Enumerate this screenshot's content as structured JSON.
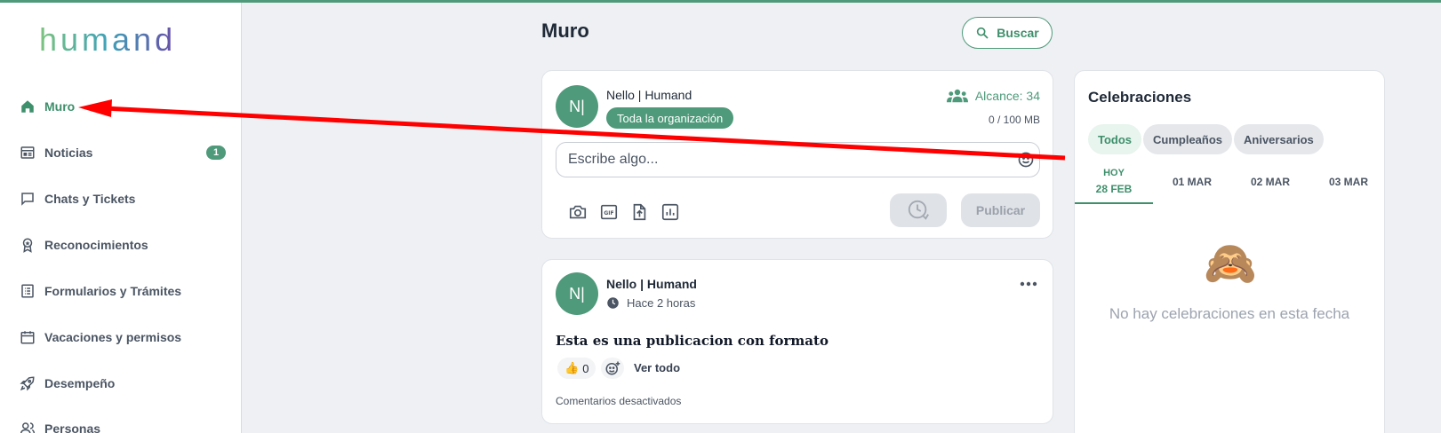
{
  "brand": {
    "logo_text": "humand"
  },
  "sidebar": {
    "items": [
      {
        "label": "Muro",
        "icon": "home-icon",
        "active": true
      },
      {
        "label": "Noticias",
        "icon": "newspaper-icon",
        "badge": "1"
      },
      {
        "label": "Chats y Tickets",
        "icon": "chat-bubble-icon"
      },
      {
        "label": "Reconocimientos",
        "icon": "award-icon"
      },
      {
        "label": "Formularios y Trámites",
        "icon": "form-list-icon"
      },
      {
        "label": "Vacaciones y permisos",
        "icon": "calendar-icon"
      },
      {
        "label": "Desempeño",
        "icon": "rocket-icon"
      },
      {
        "label": "Personas",
        "icon": "people-icon"
      }
    ]
  },
  "header": {
    "title": "Muro",
    "search_label": "Buscar"
  },
  "composer": {
    "avatar": "N|",
    "author": "Nello | Humand",
    "audience": "Toda la organización",
    "reach_label": "Alcance: 34",
    "storage": "0 / 100 MB",
    "placeholder": "Escribe algo...",
    "tools": [
      "camera-icon",
      "gif-icon",
      "file-upload-icon",
      "poll-icon"
    ],
    "publish_label": "Publicar"
  },
  "post": {
    "avatar": "N|",
    "author": "Nello | Humand",
    "time": "Hace 2 horas",
    "text": "Esta es una publicacion con formato",
    "reaction_emoji": "👍",
    "reaction_count": "0",
    "see_all": "Ver todo",
    "comments_status": "Comentarios desactivados"
  },
  "celebrations": {
    "title": "Celebraciones",
    "filters": [
      "Todos",
      "Cumpleaños",
      "Aniversarios"
    ],
    "active_filter": "Todos",
    "dates": [
      {
        "top": "HOY",
        "label": "28 FEB",
        "active": true
      },
      {
        "top": "",
        "label": "01 MAR"
      },
      {
        "top": "",
        "label": "02 MAR"
      },
      {
        "top": "",
        "label": "03 MAR"
      }
    ],
    "empty_emoji": "🙈",
    "empty_message": "No hay celebraciones en esta fecha"
  },
  "colors": {
    "accent": "#4e9a7a",
    "annotation_arrow": "#ff0000"
  }
}
